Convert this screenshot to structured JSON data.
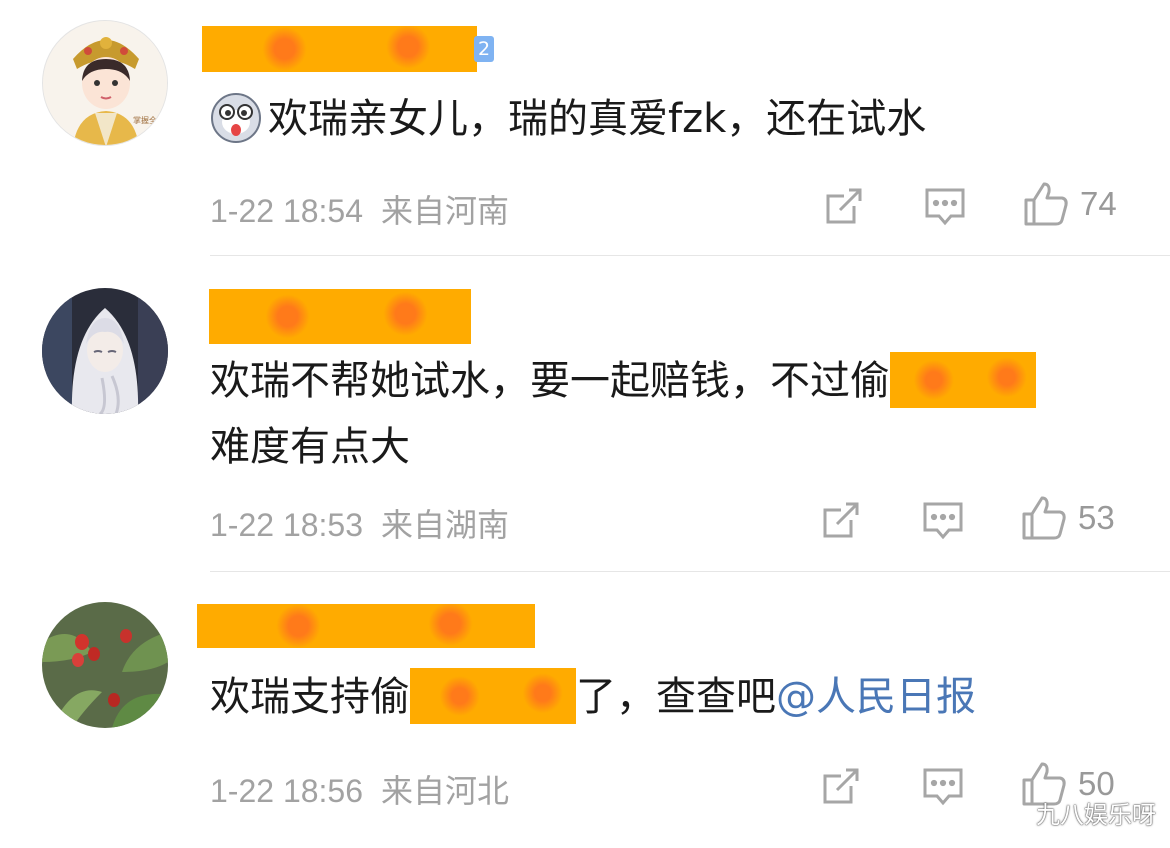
{
  "comments": [
    {
      "badge_level": "2",
      "emoji": "dog-face-emoji",
      "text": "欢瑞亲女儿，瑞的真爱fzk，还在试水",
      "time": "1-22 18:54",
      "location": "来自河南",
      "likes": "74"
    },
    {
      "text_line1": "欢瑞不帮她试水，要一起赔钱，不过偷",
      "text_line2": "难度有点大",
      "time": "1-22 18:53",
      "location": "来自湖南",
      "likes": "53"
    },
    {
      "text_before": "欢瑞支持偷",
      "text_after": "了，查查吧",
      "mention": "@人民日报",
      "time": "1-22 18:56",
      "location": "来自河北",
      "likes": "50"
    }
  ],
  "watermark": "九八娱乐呀",
  "icons": {
    "share": "share-icon",
    "reply": "comment-icon",
    "like": "thumbs-up-icon"
  }
}
